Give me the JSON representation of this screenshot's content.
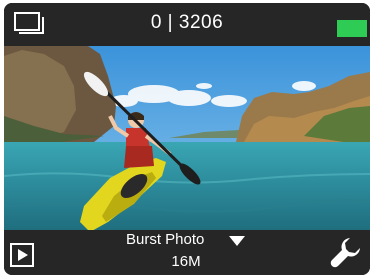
{
  "status_bar": {
    "counter": "0 | 3206",
    "gallery_icon": "gallery-stack-icon",
    "battery_icon": "battery-full-icon",
    "battery_level": 1.0,
    "battery_color": "#2ecc55"
  },
  "preview": {
    "description_icon": "camera-live-preview",
    "sky_color": "#4aa3e0",
    "water_color": "#2f8fa0"
  },
  "bottom_bar": {
    "playback_icon": "play-icon",
    "mode_label": "Burst Photo",
    "mode_dropdown_icon": "caret-down-icon",
    "resolution_label": "16M",
    "settings_icon": "wrench-icon"
  }
}
